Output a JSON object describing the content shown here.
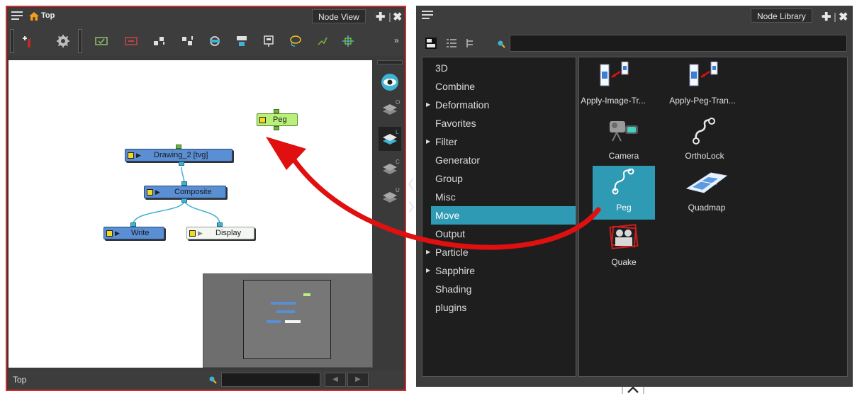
{
  "node_view": {
    "breadcrumb": "Top",
    "tab_label": "Node View",
    "status_label": "Top",
    "nodes": {
      "peg": "Peg",
      "drawing": "Drawing_2 [tvg]",
      "composite": "Composite",
      "write": "Write",
      "display": "Display"
    },
    "toolbar_icons": [
      "add-node-icon",
      "gear-icon",
      "enable-icon",
      "disable-icon",
      "cascade-up-icon",
      "cascade-down-icon",
      "navigate-icon",
      "group-icon",
      "display-icon",
      "lasso-icon",
      "select-icon",
      "network-icon",
      "more-icon"
    ],
    "side_icons": [
      "eye-icon",
      "layers-o-icon",
      "layers-l-icon",
      "layers-c-icon",
      "layers-u-icon"
    ],
    "side_letters": [
      "O",
      "L",
      "C",
      "U"
    ]
  },
  "node_library": {
    "tab_label": "Node Library",
    "search_value": "",
    "categories": [
      {
        "label": "3D",
        "expandable": false,
        "selected": false
      },
      {
        "label": "Combine",
        "expandable": false,
        "selected": false
      },
      {
        "label": "Deformation",
        "expandable": true,
        "selected": false
      },
      {
        "label": "Favorites",
        "expandable": false,
        "selected": false
      },
      {
        "label": "Filter",
        "expandable": true,
        "selected": false
      },
      {
        "label": "Generator",
        "expandable": false,
        "selected": false
      },
      {
        "label": "Group",
        "expandable": false,
        "selected": false
      },
      {
        "label": "Misc",
        "expandable": false,
        "selected": false
      },
      {
        "label": "Move",
        "expandable": false,
        "selected": true
      },
      {
        "label": "Output",
        "expandable": false,
        "selected": false
      },
      {
        "label": "Particle",
        "expandable": true,
        "selected": false
      },
      {
        "label": "Sapphire",
        "expandable": true,
        "selected": false
      },
      {
        "label": "Shading",
        "expandable": false,
        "selected": false
      },
      {
        "label": "plugins",
        "expandable": false,
        "selected": false
      }
    ],
    "items": [
      {
        "label": "Apply-Image-Tr...",
        "icon": "apply-image-transform-icon",
        "selected": false
      },
      {
        "label": "Apply-Peg-Tran...",
        "icon": "apply-peg-transform-icon",
        "selected": false
      },
      {
        "label": "Camera",
        "icon": "camera-icon",
        "selected": false
      },
      {
        "label": "OrthoLock",
        "icon": "ortholock-icon",
        "selected": false
      },
      {
        "label": "Peg",
        "icon": "peg-icon",
        "selected": true
      },
      {
        "label": "Quadmap",
        "icon": "quadmap-icon",
        "selected": false
      },
      {
        "label": "Quake",
        "icon": "quake-icon",
        "selected": false
      }
    ]
  },
  "colors": {
    "selection": "#2f9ab3",
    "panel_highlight": "#d42a2a",
    "node_blue": "#5b8fd4",
    "peg_green": "#b9f07a",
    "drag_arrow": "#e01010"
  }
}
